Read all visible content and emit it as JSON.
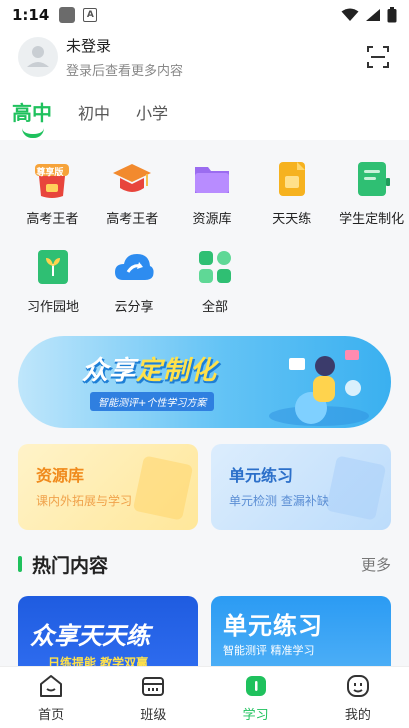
{
  "status_bar": {
    "time": "1:14",
    "a_glyph": "A"
  },
  "user": {
    "name": "未登录",
    "subtitle": "登录后查看更多内容"
  },
  "level_tabs": [
    {
      "label": "高中",
      "active": true
    },
    {
      "label": "初中",
      "active": false
    },
    {
      "label": "小学",
      "active": false
    }
  ],
  "grid": {
    "items": [
      {
        "label": "高考王者",
        "icon": "premium-cap-icon",
        "badge": "尊享版"
      },
      {
        "label": "高考王者",
        "icon": "graduation-cap-icon"
      },
      {
        "label": "资源库",
        "icon": "folder-icon"
      },
      {
        "label": "天天练",
        "icon": "document-icon"
      },
      {
        "label": "学生定制化",
        "icon": "notebook-icon"
      },
      {
        "label": "习作园地",
        "icon": "plant-book-icon"
      },
      {
        "label": "云分享",
        "icon": "cloud-share-icon"
      },
      {
        "label": "全部",
        "icon": "grid-apps-icon"
      }
    ]
  },
  "banner": {
    "title_a": "众享",
    "title_b": "定制化",
    "subtitle": "智能测评+个性学习方案"
  },
  "cards": {
    "left": {
      "title": "资源库",
      "subtitle": "课内外拓展与学习"
    },
    "right": {
      "title": "单元练习",
      "subtitle": "单元检测  查漏补缺"
    }
  },
  "hot": {
    "title": "热门内容",
    "more": "更多",
    "left": {
      "title": "众享天天练",
      "subtitle": "日练提能  教学双赢"
    },
    "right": {
      "title": "单元练习",
      "subtitle": "智能测评  精准学习"
    }
  },
  "bottom_nav": [
    {
      "label": "首页",
      "icon": "home-icon",
      "active": false
    },
    {
      "label": "班级",
      "icon": "class-icon",
      "active": false
    },
    {
      "label": "学习",
      "icon": "study-icon",
      "active": true
    },
    {
      "label": "我的",
      "icon": "profile-icon",
      "active": false
    }
  ],
  "colors": {
    "accent": "#1fc15d",
    "background": "#f6f7f9"
  }
}
